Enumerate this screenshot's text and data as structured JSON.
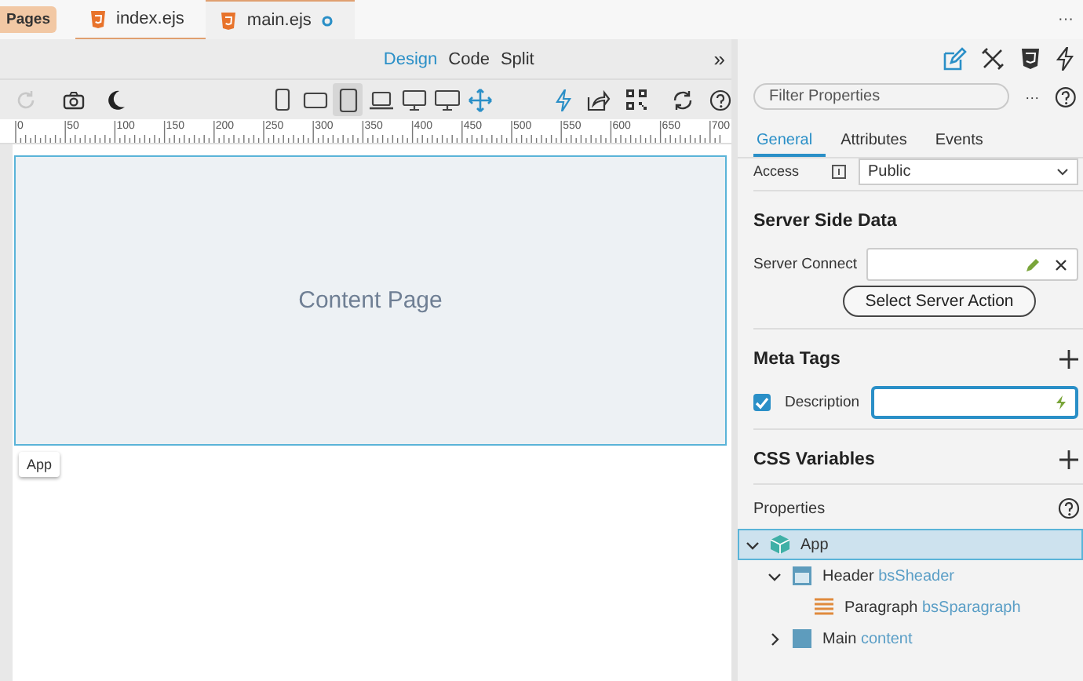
{
  "pages_badge": "Pages",
  "file_tabs": [
    {
      "label": "index.ejs",
      "selected": false,
      "modified": false
    },
    {
      "label": "main.ejs",
      "selected": true,
      "modified": true
    }
  ],
  "tabbar_menu": "···",
  "view_modes": [
    {
      "label": "Design",
      "selected": true
    },
    {
      "label": "Code",
      "selected": false
    },
    {
      "label": "Split",
      "selected": false
    }
  ],
  "view_more": "»",
  "devices": [
    {
      "kind": "phone",
      "selected": false
    },
    {
      "kind": "phone-landscape",
      "selected": false
    },
    {
      "kind": "tablet",
      "selected": true
    },
    {
      "kind": "laptop",
      "selected": false
    },
    {
      "kind": "desktop",
      "selected": false
    },
    {
      "kind": "wide",
      "selected": false
    },
    {
      "kind": "resize",
      "selected": false
    }
  ],
  "ruler_labels": [
    "0",
    "50",
    "100",
    "150",
    "200",
    "250",
    "300",
    "350",
    "400",
    "450",
    "500",
    "550",
    "600",
    "650",
    "700"
  ],
  "canvas": {
    "content_text": "Content Page",
    "element_label": "App"
  },
  "panel_icons": [
    {
      "kind": "edit",
      "selected": true
    },
    {
      "kind": "tools",
      "selected": false
    },
    {
      "kind": "css",
      "selected": false
    },
    {
      "kind": "bolt",
      "selected": false
    }
  ],
  "filter": {
    "placeholder": "Filter Properties",
    "menu": "···"
  },
  "panel_tabs": [
    {
      "label": "General",
      "selected": true
    },
    {
      "label": "Attributes",
      "selected": false
    },
    {
      "label": "Events",
      "selected": false
    }
  ],
  "access": {
    "label": "Access",
    "value": "Public"
  },
  "sections": [
    {
      "kind": "server",
      "title": "Server Side Data",
      "field_label": "Server Connect",
      "button": "Select Server Action"
    },
    {
      "kind": "meta",
      "title": "Meta Tags",
      "field_label": "Description",
      "checked": true
    },
    {
      "kind": "css",
      "title": "CSS Variables"
    }
  ],
  "properties": {
    "title": "Properties",
    "tree": [
      {
        "kind": "app",
        "label": "App",
        "selected": true,
        "expanded": true,
        "children": [
          {
            "kind": "header",
            "label": "Header",
            "id_text": "bsSheader",
            "selected": false,
            "expanded": true,
            "children": [
              {
                "kind": "paragraph",
                "label": "Paragraph",
                "id_text": "bsSparagraph",
                "selected": false
              }
            ]
          },
          {
            "kind": "main",
            "label": "Main",
            "id_text": "content",
            "selected": false,
            "expanded": false
          }
        ]
      }
    ]
  }
}
